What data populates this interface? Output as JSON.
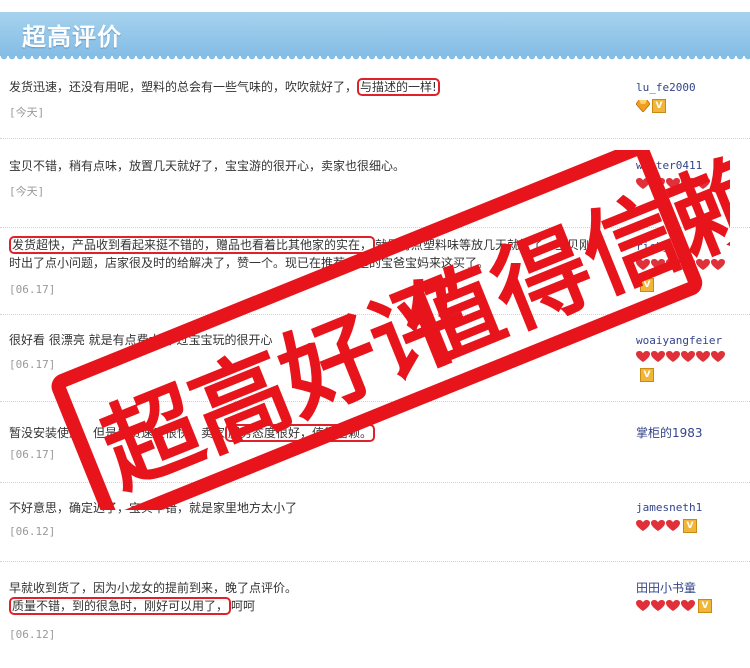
{
  "header": {
    "title": "超高评价"
  },
  "reviews": [
    {
      "pre": "发货迅速，还没有用呢，塑料的总会有一些气味的，吹吹就好了，",
      "hl": "与描述的一样!",
      "post": "",
      "date": "[今天]",
      "user": "lu_fe2000",
      "badges": "diamond+v"
    },
    {
      "pre": "宝贝不错，稍有点味，放置几天就好了，宝宝游的很开心，卖家也很细心。",
      "hl": "",
      "post": "",
      "date": "[今天]",
      "user": "winter0411",
      "badges": "hearts5"
    },
    {
      "pre": "",
      "hl": "发货超快，产品收到看起来挺不错的，赠品也看着比其他家的实在，",
      "post": "就是有点塑料味等放几天就好了，宝贝刚到时出了点小问题，店家很及时的给解决了，赞一个。现已在推荐身边的宝爸宝妈来这买了。",
      "date": "[06.17]",
      "user": "ricky_jj",
      "badges": "hearts5+v"
    },
    {
      "pre": "很好看 很漂亮 就是有点费水 不过宝宝玩的很开心",
      "hl": "",
      "post": "",
      "date": "[06.17]",
      "user": "woaiyangfeier",
      "badges": "hearts5+v"
    },
    {
      "pre": "暂没安装使用，但是发货速度很快，卖家",
      "hl": "服务态度很好，值得信赖。",
      "post": "",
      "date": "[06.17]",
      "user": "掌柜的1983",
      "badges": ""
    },
    {
      "pre": "不好意思，确定迟了，宝贝不错，就是家里地方太小了",
      "hl": "",
      "post": "",
      "date": "[06.12]",
      "user": "jamesneth1",
      "badges": "hearts3+v"
    },
    {
      "pre": "早就收到货了，因为小龙女的提前到来，晚了点评价。",
      "hl": "质量不错，到的很急时，刚好可以用了，",
      "post": "呵呵",
      "date": "[06.12]",
      "user": "田田小书童",
      "badges": "hearts4+v"
    }
  ],
  "stamp": {
    "line1": "超高好评",
    "line2": "值得信赖"
  },
  "colors": {
    "header": "#8cc3e8",
    "highlight": "#e0212a",
    "stamp": "#e8141c",
    "heart": "#e0303a"
  }
}
